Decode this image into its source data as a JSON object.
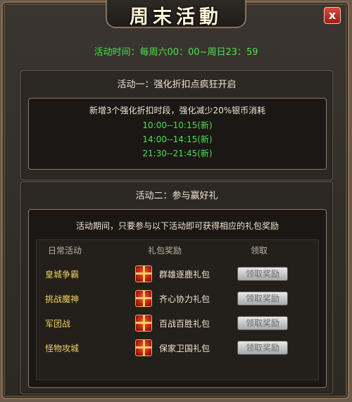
{
  "window": {
    "title": "周末活動",
    "close_label": "x"
  },
  "event_time": "活动时间：每周六00：00~周日23：59",
  "activity1": {
    "title": "活动一：强化折扣点疯狂开启",
    "description": "新增3个强化折扣时段，强化减少20%银币消耗",
    "slots": [
      "10:00--10:15(新)",
      "14:00--14:15(新)",
      "21:30--21:45(新)"
    ]
  },
  "activity2": {
    "title": "活动二：参与赢好礼",
    "description": "活动期间，只要参与以下活动即可获得相应的礼包奖励",
    "headers": {
      "daily": "日常活动",
      "reward": "礼包奖励",
      "claim": "领取"
    },
    "rows": [
      {
        "activity": "皇城争霸",
        "gift": "群雄逐鹿礼包",
        "button": "领取奖励"
      },
      {
        "activity": "挑战魔神",
        "gift": "齐心协力礼包",
        "button": "领取奖励"
      },
      {
        "activity": "军团战",
        "gift": "百战百胜礼包",
        "button": "领取奖励"
      },
      {
        "activity": "怪物攻城",
        "gift": "保家卫国礼包",
        "button": "领取奖励"
      }
    ]
  },
  "colors": {
    "highlight_green": "#4ee04e",
    "activity_name_gold": "#f0d25a",
    "close_red": "#c0392b"
  }
}
